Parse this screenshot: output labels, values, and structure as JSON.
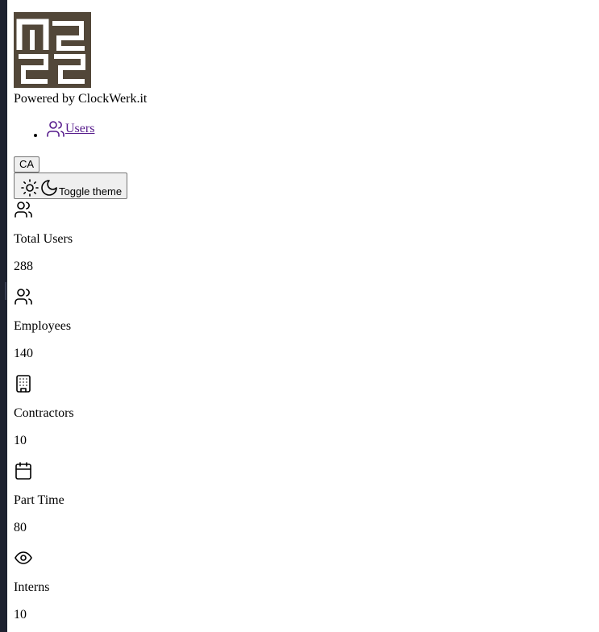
{
  "brand": {
    "logo_icon": "maze-logo",
    "logo_color": "#524739",
    "powered_by": "Powered by ClockWerk.it"
  },
  "nav": {
    "items": [
      {
        "label": "Users",
        "icon": "users-icon"
      }
    ]
  },
  "header": {
    "avatar_label": "CA",
    "theme_toggle_label": "Toggle theme"
  },
  "stats": [
    {
      "icon": "users-icon",
      "label": "Total Users",
      "value": "288"
    },
    {
      "icon": "users-icon",
      "label": "Employees",
      "value": "140"
    },
    {
      "icon": "building-icon",
      "label": "Contractors",
      "value": "10"
    },
    {
      "icon": "calendar-icon",
      "label": "Part Time",
      "value": "80"
    },
    {
      "icon": "eye-icon",
      "label": "Interns",
      "value": "10"
    }
  ],
  "colors": {
    "link": "#551a8b",
    "sidebar_edge": "#1e2230"
  }
}
